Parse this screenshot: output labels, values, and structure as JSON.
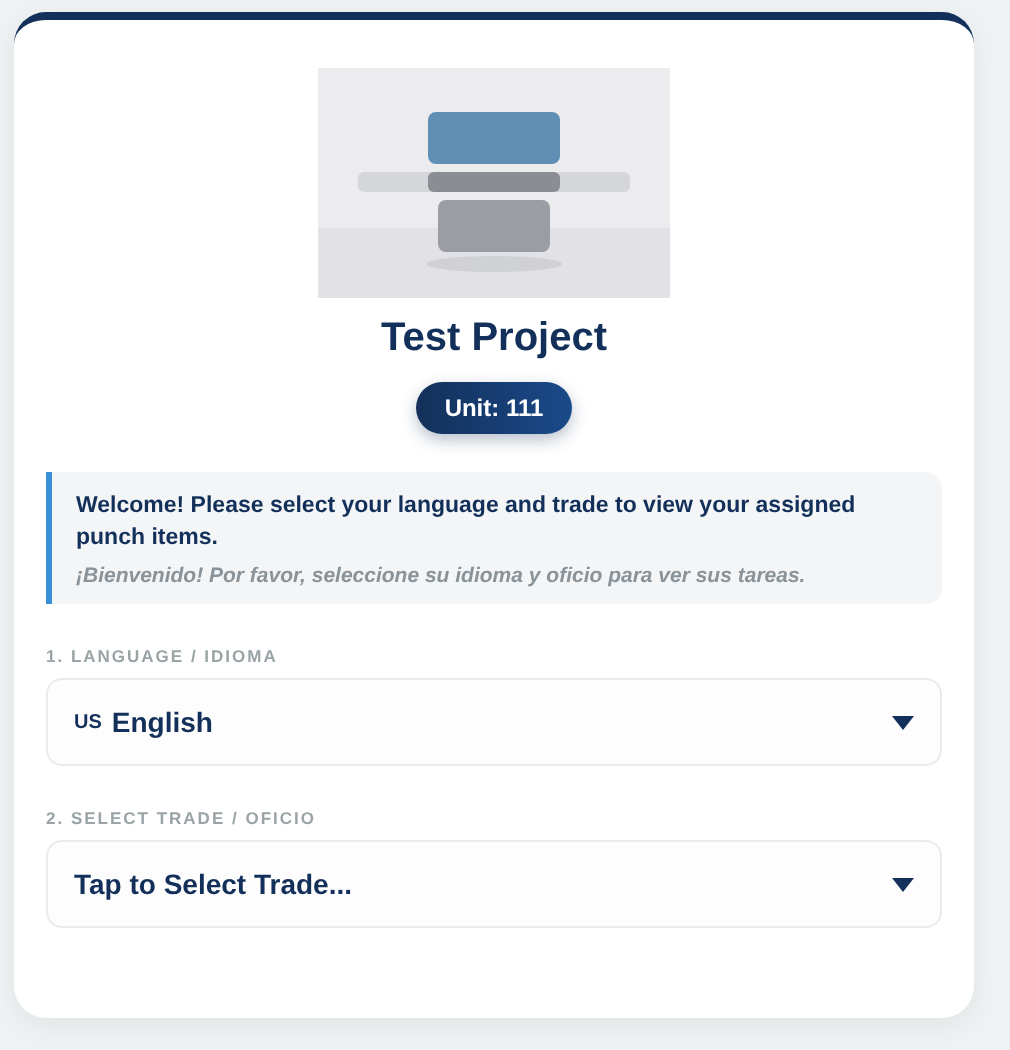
{
  "project": {
    "title": "Test Project",
    "unit": "Unit: 111"
  },
  "notice": {
    "english": "Welcome! Please select your language and trade to view your assigned punch items.",
    "spanish": "¡Bienvenido! Por favor, seleccione su idioma y oficio para ver sus tareas."
  },
  "fields": [
    {
      "label": "1. LANGUAGE / IDIOMA",
      "flag": "US",
      "value": "English"
    },
    {
      "label": "2. SELECT TRADE / OFICIO",
      "value": "Tap to Select Trade..."
    }
  ]
}
